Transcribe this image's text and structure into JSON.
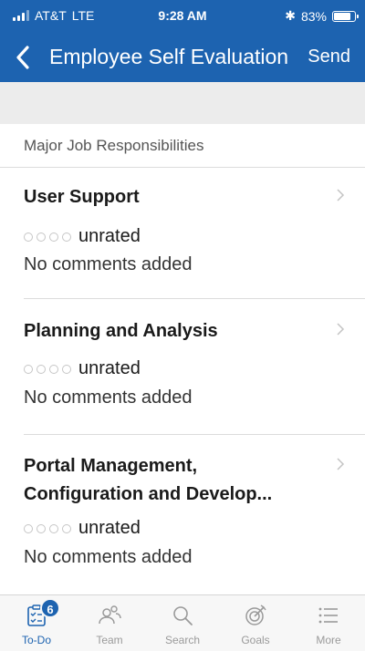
{
  "status_bar": {
    "carrier": "AT&T",
    "network": "LTE",
    "time": "9:28 AM",
    "bluetooth": "✱",
    "battery_percent": "83%",
    "battery_level": 0.83
  },
  "nav": {
    "title": "Employee Self Evaluation",
    "send_label": "Send"
  },
  "section": {
    "header": "Major Job Responsibilities"
  },
  "items": [
    {
      "title": "User Support",
      "rating": "unrated",
      "comments": "No comments added"
    },
    {
      "title": "Planning and Analysis",
      "rating": "unrated",
      "comments": "No comments added"
    },
    {
      "title": "Portal Management, Configuration and Develop...",
      "rating": "unrated",
      "comments": "No comments added"
    }
  ],
  "tabs": [
    {
      "label": "To-Do",
      "icon": "todo-icon",
      "badge": "6",
      "active": true
    },
    {
      "label": "Team",
      "icon": "team-icon"
    },
    {
      "label": "Search",
      "icon": "search-icon"
    },
    {
      "label": "Goals",
      "icon": "goals-icon"
    },
    {
      "label": "More",
      "icon": "more-icon"
    }
  ],
  "colors": {
    "brand": "#1d63b0",
    "band": "#ececec",
    "inactive_tab": "#9a9a9a"
  }
}
